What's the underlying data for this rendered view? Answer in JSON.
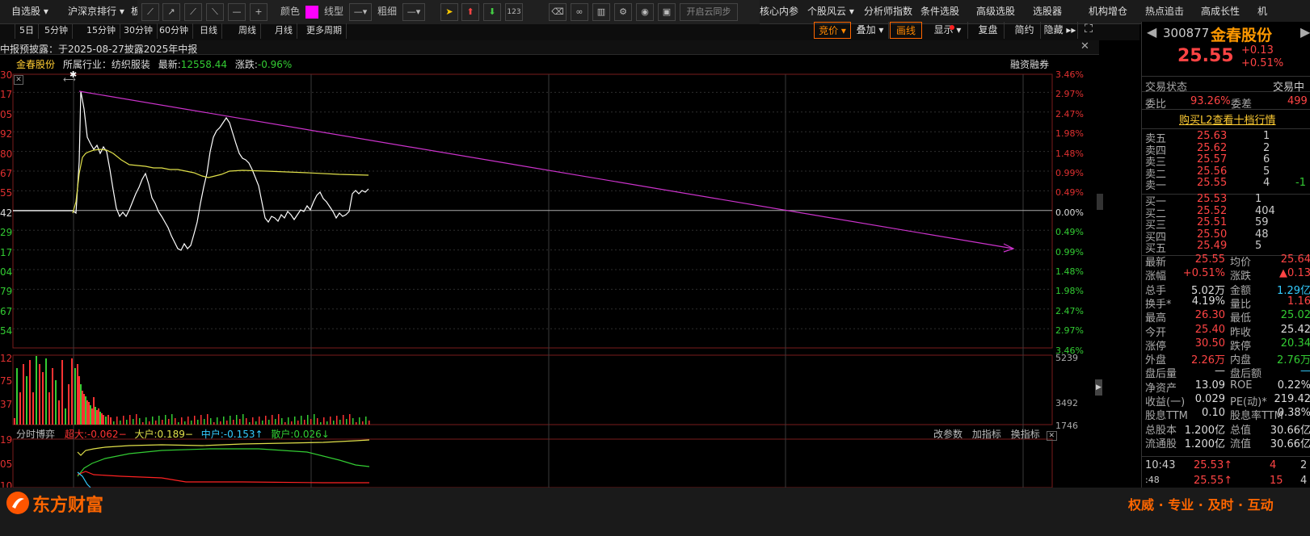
{
  "topbar": {
    "menus": [
      "自选股",
      "沪深京排行",
      "板"
    ],
    "color_label": "颜色",
    "line_type_label": "线型",
    "thickness_label": "粗细",
    "cloud_sync": "开启云同步",
    "right_menus": [
      "核心内参",
      "个股风云",
      "分析师指数",
      "条件选股",
      "高级选股",
      "选股器",
      "机构增仓",
      "热点追击",
      "高成长性",
      "机"
    ]
  },
  "periods": [
    "5日",
    "5分钟",
    "15分钟",
    "30分钟",
    "60分钟",
    "日线",
    "周线",
    "月线",
    "更多周期"
  ],
  "chart_toolbar": [
    "竞价",
    "叠加",
    "画线",
    "显示",
    "复盘",
    "简约",
    "隐藏"
  ],
  "notice": "中报预披露：于2025-08-27披露2025年中报",
  "info": {
    "name": "金春股份",
    "industry": "所属行业：纺织服装",
    "latest_label": "最新:",
    "latest_value": "12558.44",
    "change_label": "涨跌:",
    "change_value": "-0.96%",
    "margin": "融资融券"
  },
  "axis_left": [
    "30",
    "17",
    "05",
    "92",
    "80",
    "67",
    "55",
    "42",
    "29",
    "17",
    "04",
    "79",
    "67",
    "54"
  ],
  "axis_right": [
    "3.46%",
    "2.97%",
    "2.47%",
    "1.98%",
    "1.48%",
    "0.99%",
    "0.49%",
    "0.00%",
    "0.49%",
    "0.99%",
    "1.48%",
    "1.98%",
    "2.47%",
    "2.97%",
    "3.46%"
  ],
  "volume_left": [
    "12",
    "75",
    "37"
  ],
  "volume_right": [
    "5239",
    "3492",
    "1746"
  ],
  "fund_flow": {
    "title": "分时博弈",
    "super_large": "超大:-0.062−",
    "large": "大户:0.189−",
    "medium": "中户:-0.153↑",
    "retail": "散户:0.026↓",
    "buttons": [
      "改参数",
      "加指标",
      "换指标"
    ]
  },
  "fund_left": [
    "19",
    "05",
    "10"
  ],
  "colors": {
    "up": "#ff3333",
    "down": "#33cc33",
    "price_line": "#ffffff",
    "avg_line": "#e0e04a",
    "trend_line": "#cc33cc",
    "accent": "#ff8800"
  },
  "quote": {
    "code": "300877",
    "name": "金春股份",
    "price": "25.55",
    "change": "+0.13",
    "change_pct": "+0.51%",
    "status_label": "交易状态",
    "status_value": "交易中",
    "webi_label": "委比",
    "webi_value": "93.26%",
    "weicha_label": "委差",
    "weicha_value": "499",
    "l2_link": "购买L2查看十档行情",
    "asks": [
      {
        "label": "卖五",
        "price": "25.63",
        "vol": "1",
        "chg": ""
      },
      {
        "label": "卖四",
        "price": "25.62",
        "vol": "2",
        "chg": ""
      },
      {
        "label": "卖三",
        "price": "25.57",
        "vol": "6",
        "chg": ""
      },
      {
        "label": "卖二",
        "price": "25.56",
        "vol": "5",
        "chg": ""
      },
      {
        "label": "卖一",
        "price": "25.55",
        "vol": "4",
        "chg": "-1"
      }
    ],
    "bids": [
      {
        "label": "买一",
        "price": "25.53",
        "vol": "1"
      },
      {
        "label": "买二",
        "price": "25.52",
        "vol": "404"
      },
      {
        "label": "买三",
        "price": "25.51",
        "vol": "59"
      },
      {
        "label": "买四",
        "price": "25.50",
        "vol": "48"
      },
      {
        "label": "买五",
        "price": "25.49",
        "vol": "5"
      }
    ],
    "stats": [
      [
        "最新",
        "25.55",
        "均价",
        "25.64"
      ],
      [
        "涨幅",
        "+0.51%",
        "涨跌",
        "▲0.13"
      ],
      [
        "总手",
        "5.02万",
        "金额",
        "1.29亿"
      ],
      [
        "换手*",
        "4.19%",
        "量比",
        "1.16"
      ],
      [
        "最高",
        "26.30",
        "最低",
        "25.02"
      ],
      [
        "今开",
        "25.40",
        "昨收",
        "25.42"
      ],
      [
        "涨停",
        "30.50",
        "跌停",
        "20.34"
      ],
      [
        "外盘",
        "2.26万",
        "内盘",
        "2.76万"
      ],
      [
        "盘后量",
        "—",
        "盘后额",
        "—"
      ],
      [
        "净资产",
        "13.09",
        "ROE",
        "0.22%"
      ],
      [
        "收益(一)",
        "0.029",
        "PE(动)*",
        "219.42"
      ],
      [
        "股息TTM",
        "0.10",
        "股息率TTM",
        "0.38%"
      ],
      [
        "总股本",
        "1.200亿",
        "总值",
        "30.66亿"
      ],
      [
        "流通股",
        "1.200亿",
        "流值",
        "30.66亿"
      ]
    ],
    "ticks": [
      {
        "time": "10:43",
        "price": "25.53↑",
        "vol": "4",
        "n": "2"
      },
      {
        "time": ":48",
        "price": "25.55↑",
        "vol": "15",
        "n": "4"
      }
    ]
  },
  "footer": {
    "brand": "东方财富",
    "slogan": "权威 · 专业 · 及时 · 互动"
  }
}
